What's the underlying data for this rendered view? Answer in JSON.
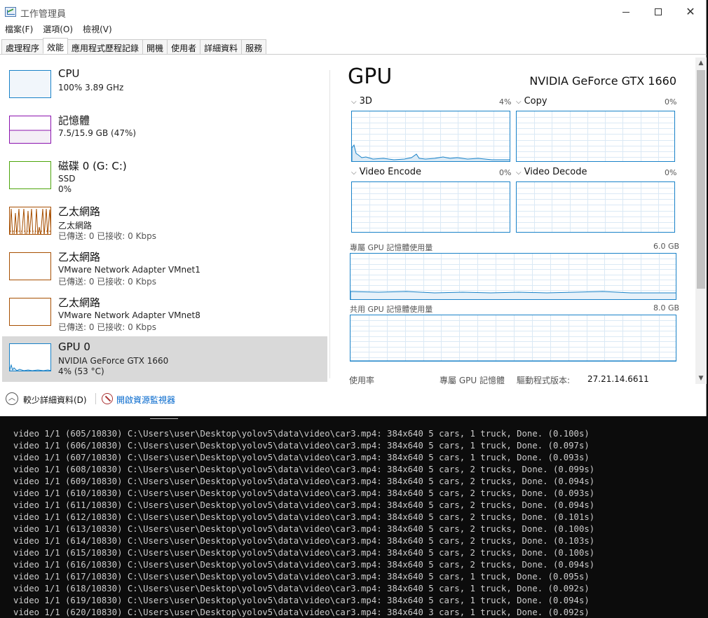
{
  "window": {
    "title": "工作管理員",
    "menu": [
      "檔案(F)",
      "選項(O)",
      "檢視(V)"
    ],
    "tabs": [
      "處理程序",
      "效能",
      "應用程式歷程記錄",
      "開機",
      "使用者",
      "詳細資料",
      "服務"
    ],
    "active_tab": 1,
    "controls": {
      "minimize": "minimize",
      "maximize": "maximize",
      "close": "✕"
    }
  },
  "sidebar": {
    "items": [
      {
        "name": "CPU",
        "line1": "100% 3.89 GHz",
        "line2": "",
        "line3": "",
        "color": "#1982c8"
      },
      {
        "name": "記憶體",
        "line1": "7.5/15.9 GB (47%)",
        "line2": "",
        "line3": "",
        "color": "#8b12ae"
      },
      {
        "name": "磁碟 0 (G: C:)",
        "line1": "SSD",
        "line2": "0%",
        "line3": "",
        "color": "#4da60c"
      },
      {
        "name": "乙太網路",
        "line1": "乙太網路",
        "line2": "已傳送: 0 已接收: 0 Kbps",
        "line3": "",
        "color": "#a74f01"
      },
      {
        "name": "乙太網路",
        "line1": "VMware Network Adapter VMnet1",
        "line2": "已傳送: 0 已接收: 0 Kbps",
        "line3": "",
        "color": "#a74f01"
      },
      {
        "name": "乙太網路",
        "line1": "VMware Network Adapter VMnet8",
        "line2": "已傳送: 0 已接收: 0 Kbps",
        "line3": "",
        "color": "#a74f01"
      },
      {
        "name": "GPU 0",
        "line1": "NVIDIA GeForce GTX 1660",
        "line2": "4% (53 °C)",
        "line3": "",
        "color": "#1982c8"
      }
    ],
    "selected_index": 6
  },
  "gpu": {
    "title": "GPU",
    "model": "NVIDIA GeForce GTX 1660",
    "engines": [
      {
        "label": "3D",
        "percent": "4%"
      },
      {
        "label": "Copy",
        "percent": "0%"
      },
      {
        "label": "Video Encode",
        "percent": "0%"
      },
      {
        "label": "Video Decode",
        "percent": "0%"
      }
    ],
    "dedicated_memory": {
      "label": "專屬 GPU 記憶體使用量",
      "max": "6.0 GB"
    },
    "shared_memory": {
      "label": "共用 GPU 記憶體使用量",
      "max": "8.0 GB"
    },
    "bottom_labels": {
      "usage": "使用率",
      "dedicated": "專屬 GPU 記憶體",
      "driver_label": "驅動程式版本:",
      "driver_version": "27.21.14.6611"
    }
  },
  "footer": {
    "fewer_details": "較少詳細資料(D)",
    "resource_monitor": "開啟資源監視器"
  },
  "terminal": {
    "lines": [
      "video 1/1 (605/10830) C:\\Users\\user\\Desktop\\yolov5\\data\\video\\car3.mp4: 384x640 5 cars, 1 truck, Done. (0.100s)",
      "video 1/1 (606/10830) C:\\Users\\user\\Desktop\\yolov5\\data\\video\\car3.mp4: 384x640 5 cars, 1 truck, Done. (0.097s)",
      "video 1/1 (607/10830) C:\\Users\\user\\Desktop\\yolov5\\data\\video\\car3.mp4: 384x640 5 cars, 1 truck, Done. (0.093s)",
      "video 1/1 (608/10830) C:\\Users\\user\\Desktop\\yolov5\\data\\video\\car3.mp4: 384x640 5 cars, 2 trucks, Done. (0.099s)",
      "video 1/1 (609/10830) C:\\Users\\user\\Desktop\\yolov5\\data\\video\\car3.mp4: 384x640 5 cars, 2 trucks, Done. (0.094s)",
      "video 1/1 (610/10830) C:\\Users\\user\\Desktop\\yolov5\\data\\video\\car3.mp4: 384x640 5 cars, 2 trucks, Done. (0.093s)",
      "video 1/1 (611/10830) C:\\Users\\user\\Desktop\\yolov5\\data\\video\\car3.mp4: 384x640 5 cars, 2 trucks, Done. (0.094s)",
      "video 1/1 (612/10830) C:\\Users\\user\\Desktop\\yolov5\\data\\video\\car3.mp4: 384x640 5 cars, 2 trucks, Done. (0.101s)",
      "video 1/1 (613/10830) C:\\Users\\user\\Desktop\\yolov5\\data\\video\\car3.mp4: 384x640 5 cars, 2 trucks, Done. (0.100s)",
      "video 1/1 (614/10830) C:\\Users\\user\\Desktop\\yolov5\\data\\video\\car3.mp4: 384x640 5 cars, 2 trucks, Done. (0.103s)",
      "video 1/1 (615/10830) C:\\Users\\user\\Desktop\\yolov5\\data\\video\\car3.mp4: 384x640 5 cars, 2 trucks, Done. (0.100s)",
      "video 1/1 (616/10830) C:\\Users\\user\\Desktop\\yolov5\\data\\video\\car3.mp4: 384x640 5 cars, 2 trucks, Done. (0.094s)",
      "video 1/1 (617/10830) C:\\Users\\user\\Desktop\\yolov5\\data\\video\\car3.mp4: 384x640 5 cars, 1 truck, Done. (0.095s)",
      "video 1/1 (618/10830) C:\\Users\\user\\Desktop\\yolov5\\data\\video\\car3.mp4: 384x640 5 cars, 1 truck, Done. (0.092s)",
      "video 1/1 (619/10830) C:\\Users\\user\\Desktop\\yolov5\\data\\video\\car3.mp4: 384x640 5 cars, 1 truck, Done. (0.094s)",
      "video 1/1 (620/10830) C:\\Users\\user\\Desktop\\yolov5\\data\\video\\car3.mp4: 384x640 3 cars, 1 truck, Done. (0.092s)"
    ]
  }
}
